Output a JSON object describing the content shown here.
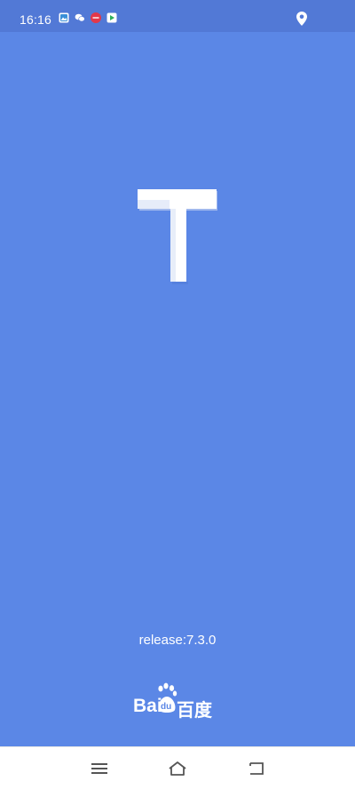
{
  "status_bar": {
    "time": "16:16",
    "notification_icons": [
      "gallery-icon",
      "wechat-icon",
      "red-badge-icon",
      "play-store-icon"
    ],
    "right_icons": [
      "location-icon"
    ],
    "background": "#5279d6"
  },
  "splash": {
    "background": "#5b87e6",
    "logo_letter": "T",
    "release_label": "release:7.3.0",
    "brand": {
      "latin": "Bai",
      "latin_suffix": "du",
      "chinese": "百度"
    }
  },
  "nav_bar": {
    "buttons": [
      "menu-icon",
      "home-icon",
      "back-icon"
    ],
    "background": "#ffffff"
  }
}
